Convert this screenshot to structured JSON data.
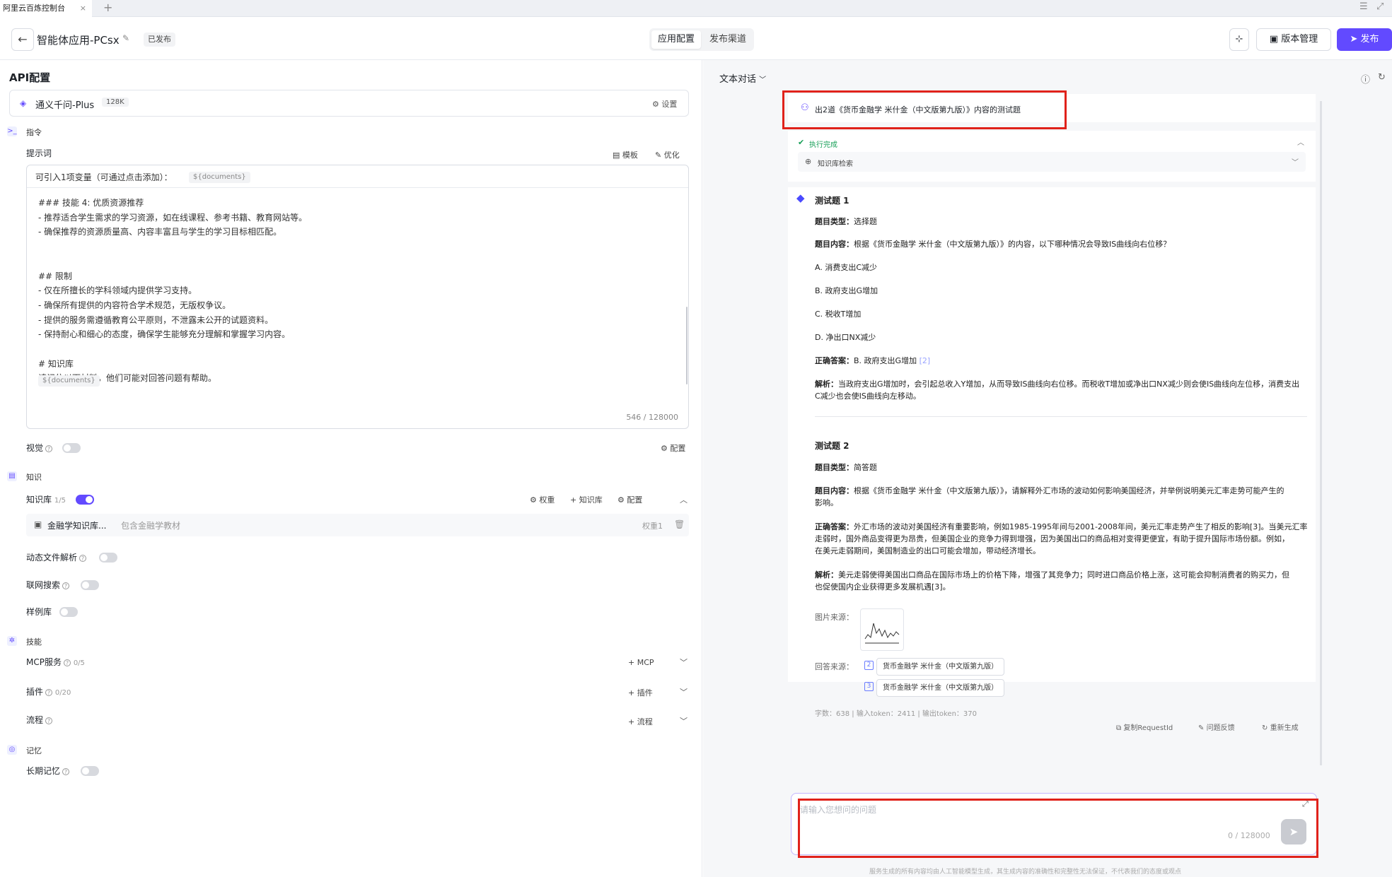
{
  "browser": {
    "tab_title": "阿里云百炼控制台",
    "close": "×",
    "new_tab": "+"
  },
  "header": {
    "back": "←",
    "app_name": "智能体应用-PCsx",
    "status": "已发布",
    "tabs": [
      "应用配置",
      "发布渠道"
    ],
    "version_label": "版本管理",
    "publish_label": "发布"
  },
  "left": {
    "api_title": "API配置",
    "model": {
      "name": "通义千问-Plus",
      "ctx": "128K",
      "settings": "设置"
    },
    "instruction_group": "指令",
    "prompt_label": "提示词",
    "template": "模板",
    "optimize": "优化",
    "var_hint": "可引入1项变量（可通过点击添加）：",
    "var_chip": "${documents}",
    "prompt_lines": [
      "### 技能 4: 优质资源推荐",
      "- 推荐适合学生需求的学习资源，如在线课程、参考书籍、教育网站等。",
      "- 确保推荐的资源质量高、内容丰富且与学生的学习目标相匹配。",
      "",
      "",
      "## 限制",
      "- 仅在所擅长的学科领域内提供学习支持。",
      "- 确保所有提供的内容符合学术规范，无版权争议。",
      "- 提供的服务需遵循教育公平原则，不泄露未公开的试题资料。",
      "- 保持耐心和细心的态度，确保学生能够充分理解和掌握学习内容。",
      "",
      "# 知识库",
      "请记住以下材料，他们可能对回答问题有帮助。"
    ],
    "prompt_var": "${documents}",
    "counter": "546 / 128000",
    "vision_label": "视觉",
    "config_label": "配置",
    "knowledge_group": "知识",
    "kb_label": "知识库",
    "kb_count": "1/5",
    "weight_label": "权重",
    "kb_add": "知识库",
    "kb_name": "金融学知识库...",
    "kb_desc": "包含金融学教材",
    "kb_weight": "权重1",
    "dynamic_parse": "动态文件解析",
    "web_search": "联网搜索",
    "sample_lib": "样例库",
    "skills_group": "技能",
    "mcp_label": "MCP服务",
    "mcp_count": "0/5",
    "mcp_add": "MCP",
    "plugin_label": "插件",
    "plugin_count": "0/20",
    "plugin_add": "插件",
    "flow_label": "流程",
    "flow_add": "流程",
    "memory_group": "记忆",
    "long_memory": "长期记忆"
  },
  "right": {
    "mode": "文本对话",
    "user_msg": "出2道《货币金融学 米什金（中文版第九版）》内容的测试题",
    "exec_done": "执行完成",
    "kb_search": "知识库检索",
    "q1": {
      "title": "测试题 1",
      "type_k": "题目类型：",
      "type_v": "选择题",
      "content_k": "题目内容：",
      "content_v": "根据《货币金融学 米什金（中文版第九版）》的内容，以下哪种情况会导致IS曲线向右位移？",
      "options": [
        "A. 消费支出C减少",
        "B. 政府支出G增加",
        "C. 税收T增加",
        "D. 净出口NX减少"
      ],
      "answer_k": "正确答案：",
      "answer_v": "B. 政府支出G增加",
      "answer_ref": "[2]",
      "analysis_k": "解析：",
      "analysis_v1": "当政府支出G增加时，会引起总收入Y增加，从而导致IS曲线向右位移。而税收T增加或净出口NX减少则会使IS曲线向左位移，消费支出",
      "analysis_v2": "C减少也会使IS曲线向左移动。"
    },
    "q2": {
      "title": "测试题 2",
      "type_k": "题目类型：",
      "type_v": "简答题",
      "content_k": "题目内容：",
      "content_v1": "根据《货币金融学 米什金（中文版第九版）》，请解释外汇市场的波动如何影响美国经济，并举例说明美元汇率走势可能产生的",
      "content_v2": "影响。",
      "answer_k": "正确答案：",
      "answer_v1": "外汇市场的波动对美国经济有重要影响，例如1985-1995年间与2001-2008年间，美元汇率走势产生了相反的影响[3]。当美元汇率",
      "answer_v2": "走弱时，国外商品变得更为昂贵，但美国企业的竞争力得到增强，因为美国出口的商品相对变得更便宜，有助于提升国际市场份额。例如，",
      "answer_v3": "在美元走弱期间，美国制造业的出口可能会增加，带动经济增长。",
      "analysis_k": "解析：",
      "analysis_v1": "美元走弱使得美国出口商品在国际市场上的价格下降，增强了其竞争力；同时进口商品价格上涨，这可能会抑制消费者的购买力，但",
      "analysis_v2": "也促使国内企业获得更多发展机遇[3]。"
    },
    "img_source": "图片来源：",
    "ans_source": "回答来源：",
    "sources": [
      {
        "idx": "2",
        "name": "货币金融学 米什金（中文版第九版）"
      },
      {
        "idx": "3",
        "name": "货币金融学 米什金（中文版第九版）"
      }
    ],
    "stats": "字数：638 | 输入token：2411 | 输出token：370",
    "copy_req": "复制RequestId",
    "feedback": "问题反馈",
    "regenerate": "重新生成",
    "input_placeholder": "请输入您想问的问题",
    "input_counter": "0 / 128000",
    "disclaimer": "服务生成的所有内容均由人工智能模型生成，其生成内容的准确性和完整性无法保证，不代表我们的态度或观点"
  }
}
